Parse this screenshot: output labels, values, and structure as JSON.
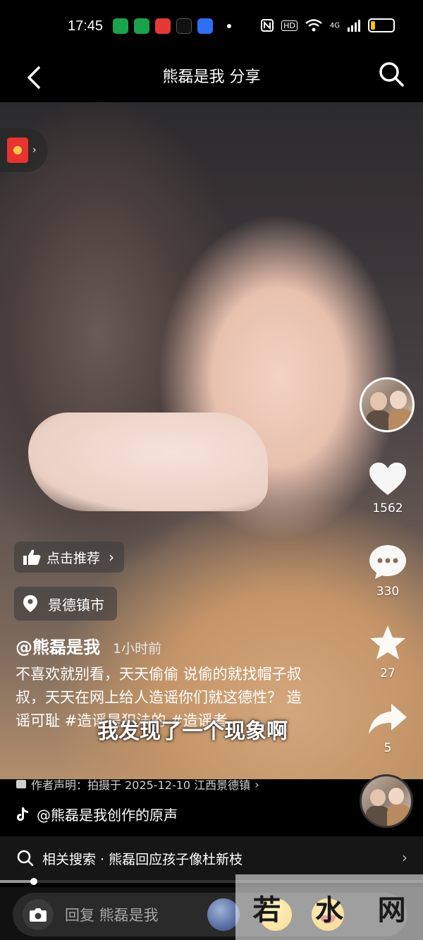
{
  "status_bar": {
    "time": "17:45",
    "network": "4G",
    "hd_label": "HD",
    "battery_level": 0.2,
    "app_icons": [
      {
        "name": "shield-app-icon",
        "color": "#1aa34a"
      },
      {
        "name": "wallet-app-icon",
        "color": "#1aa34a"
      },
      {
        "name": "red-app-icon",
        "color": "#e53935"
      },
      {
        "name": "tiktok-app-icon",
        "color": "#111111"
      },
      {
        "name": "baidu-app-icon",
        "color": "#2f6ff5"
      }
    ]
  },
  "header": {
    "title": "熊磊是我 分享"
  },
  "video": {
    "recommend_label": "点击推荐",
    "location": "景德镇市",
    "author": "@熊磊是我",
    "time_ago": "1小时前",
    "caption": "不喜欢就别看，天天偷偷 说偷的就找帽子叔叔，天天在网上给人造谣你们就这德性？ 造谣可耻 #造谣是犯法的 #造谣者",
    "subtitle": "我发现了一个现象啊",
    "declaration": "作者声明：拍摄于 2025-12-10 江西景德镇"
  },
  "rail": {
    "likes": "1562",
    "comments": "330",
    "favorites": "27",
    "shares": "5"
  },
  "sound": {
    "label": "@熊磊是我创作的原声"
  },
  "related": {
    "label": "相关搜索 · 熊磊回应孩子像杜新枝"
  },
  "playback": {
    "progress": 0.08
  },
  "comment_bar": {
    "placeholder": "回复 熊磊是我"
  },
  "watermark": {
    "chars": [
      "若",
      "水",
      "网"
    ]
  },
  "colors": {
    "accent_red": "#e8332e",
    "battery_yellow": "#f5c400",
    "background": "#000000"
  }
}
